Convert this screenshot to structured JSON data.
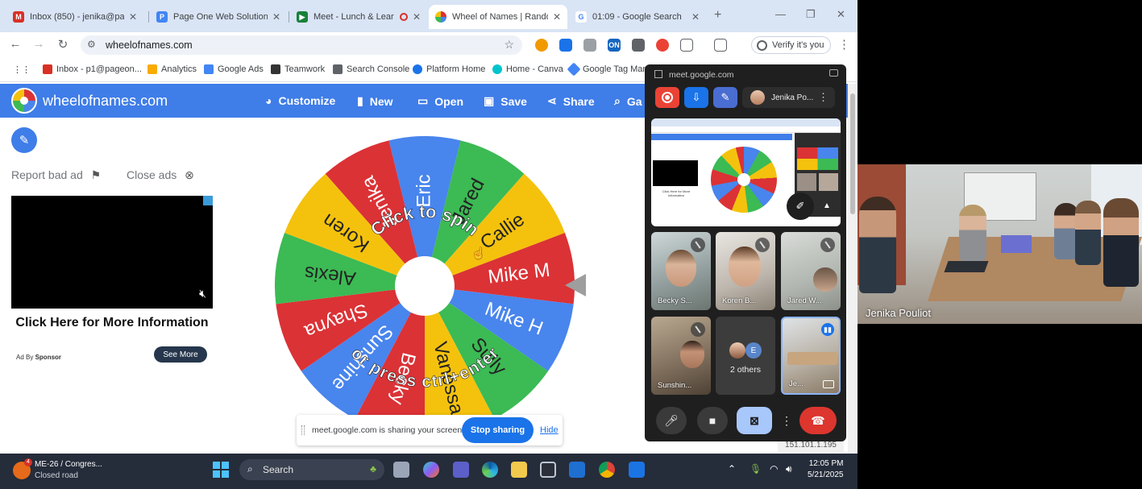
{
  "browser": {
    "tabs": [
      {
        "label": "Inbox (850) - jenika@pa...",
        "favicon_color": "#d93025",
        "active": false
      },
      {
        "label": "Page One Web Solutions",
        "favicon_color": "#4285f4",
        "active": false
      },
      {
        "label": "Meet - Lunch & Lear",
        "favicon_color": "#188038",
        "active": false,
        "recording": true
      },
      {
        "label": "Wheel of Names | Rando",
        "favicon_color": "#4285f4",
        "active": true
      },
      {
        "label": "01:09 - Google Search",
        "favicon_color": "#4285f4",
        "active": false
      }
    ],
    "tab_close": "✕",
    "new_tab": "+",
    "url": "wheelofnames.com",
    "verify_label": "Verify it's you",
    "bookmarks": [
      {
        "label": "Inbox - p1@pageon...",
        "color": "#d93025"
      },
      {
        "label": "Analytics",
        "color": "#f9ab00"
      },
      {
        "label": "Google Ads",
        "color": "#4285f4"
      },
      {
        "label": "Teamwork",
        "color": "#333333"
      },
      {
        "label": "Search Console",
        "color": "#5f6368"
      },
      {
        "label": "Platform Home",
        "color": "#1a73e8"
      },
      {
        "label": "Home - Canva",
        "color": "#00c4cc"
      },
      {
        "label": "Google Tag Mana",
        "color": "#4285f4"
      }
    ]
  },
  "site": {
    "title": "wheelofnames.com",
    "accent": "#3f7de8",
    "nav": [
      {
        "label": "Customize",
        "icon": "palette-icon"
      },
      {
        "label": "New",
        "icon": "file-icon"
      },
      {
        "label": "Open",
        "icon": "folder-icon"
      },
      {
        "label": "Save",
        "icon": "save-icon"
      },
      {
        "label": "Share",
        "icon": "share-icon"
      },
      {
        "label": "Ga",
        "icon": "search-icon"
      }
    ],
    "report_ad": "Report bad ad",
    "close_ads": "Close ads",
    "ad_cta": "Click Here for More Information",
    "ad_by": "Ad By",
    "ad_sponsor": "Sponsor",
    "see_more": "See More"
  },
  "wheel": {
    "names": [
      "Eric",
      "Jared",
      "Callie",
      "Mike M",
      "Mike H",
      "Sully",
      "Vanessa",
      "Becky",
      "Sunshine",
      "Shayna",
      "Alexis",
      "Koren",
      "Jenika"
    ],
    "colors": [
      "#4885ed",
      "#3cba54",
      "#f4c20d",
      "#db3236"
    ],
    "center_text_top": "Click to spin",
    "center_text_bottom": "or press ctrl+enter"
  },
  "share_bar": {
    "message": "meet.google.com is sharing your screen.",
    "stop_label": "Stop sharing",
    "hide_label": "Hide"
  },
  "ip_label": "151.101.1.195",
  "meet": {
    "url": "meet.google.com",
    "self_name": "Jenika Po...",
    "tiles": [
      {
        "name": "Becky S...",
        "muted": true
      },
      {
        "name": "Koren B...",
        "muted": true
      },
      {
        "name": "Jared W...",
        "muted": false
      },
      {
        "name": "Sunshin...",
        "muted": true
      },
      {
        "name": "2 others",
        "muted": false
      },
      {
        "name": "Je...",
        "muted": false
      }
    ],
    "others_initial": "E"
  },
  "camera": {
    "name": "Jenika Pouliot"
  },
  "taskbar": {
    "weather_line1": "ME-26 / Congres...",
    "weather_line2": "Closed road",
    "weather_badge": "4",
    "search_label": "Search",
    "time": "12:05 PM",
    "date": "5/21/2025"
  }
}
